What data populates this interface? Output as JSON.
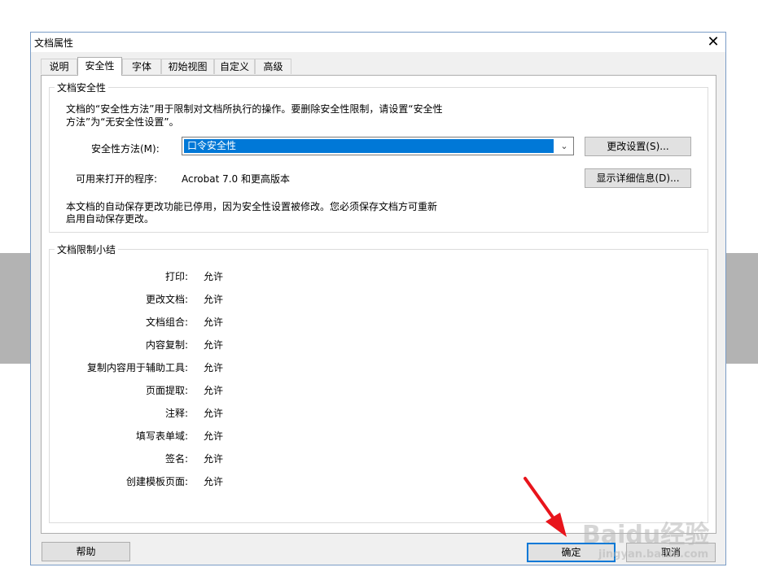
{
  "dialog": {
    "title": "文档属性",
    "close_label": "✕"
  },
  "tabs": [
    {
      "label": "说明"
    },
    {
      "label": "安全性"
    },
    {
      "label": "字体"
    },
    {
      "label": "初始视图"
    },
    {
      "label": "自定义"
    },
    {
      "label": "高级"
    }
  ],
  "security": {
    "group_label": "文档安全性",
    "description_line1": "文档的“安全性方法”用于限制对文档所执行的操作。要删除安全性限制，请设置“安全性",
    "description_line2": "方法”为“无安全性设置”。",
    "method_label": "安全性方法(M):",
    "method_value": "口令安全性",
    "change_settings_button": "更改设置(S)...",
    "open_with_label": "可用来打开的程序:",
    "open_with_value": "Acrobat 7.0 和更高版本",
    "show_details_button": "显示详细信息(D)...",
    "autosave_line1": "本文档的自动保存更改功能已停用，因为安全性设置被修改。您必须保存文档方可重新",
    "autosave_line2": "启用自动保存更改。"
  },
  "restrictions": {
    "group_label": "文档限制小结",
    "rows": [
      {
        "label": "打印:",
        "value": "允许"
      },
      {
        "label": "更改文档:",
        "value": "允许"
      },
      {
        "label": "文档组合:",
        "value": "允许"
      },
      {
        "label": "内容复制:",
        "value": "允许"
      },
      {
        "label": "复制内容用于辅助工具:",
        "value": "允许"
      },
      {
        "label": "页面提取:",
        "value": "允许"
      },
      {
        "label": "注释:",
        "value": "允许"
      },
      {
        "label": "填写表单域:",
        "value": "允许"
      },
      {
        "label": "签名:",
        "value": "允许"
      },
      {
        "label": "创建模板页面:",
        "value": "允许"
      }
    ]
  },
  "footer": {
    "help_button": "帮助",
    "ok_button": "确定",
    "cancel_button": "取消"
  },
  "watermark": {
    "brand": "Baidu经验",
    "url": "jingyan.baidu.com"
  },
  "colors": {
    "selection": "#0078d7",
    "annotation_arrow": "#e8141b"
  }
}
